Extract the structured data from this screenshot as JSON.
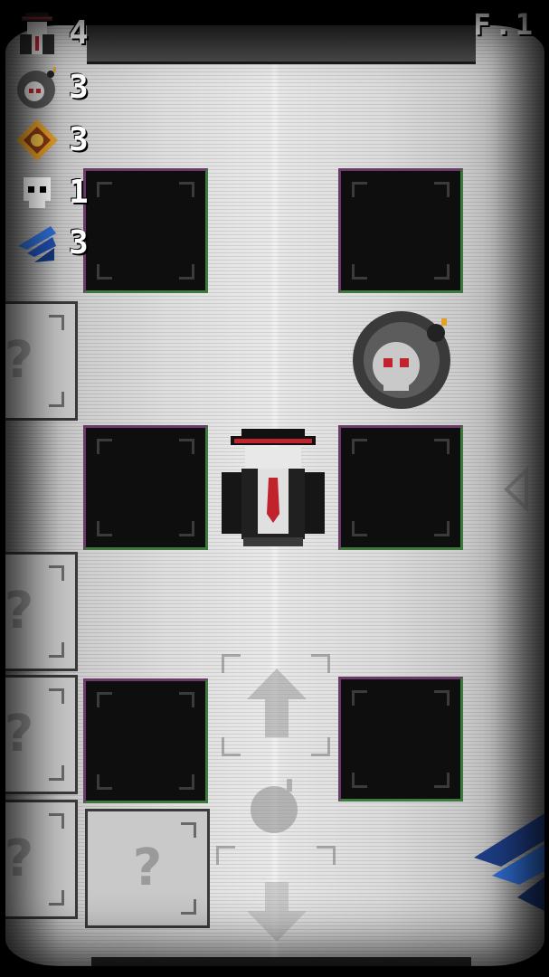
{
  "hud": {
    "lives": {
      "icon": "agent-head-icon",
      "value": "4"
    },
    "bombs": {
      "icon": "skull-bomb-icon",
      "value": "3"
    },
    "compass": {
      "icon": "compass-gem-icon",
      "value": "3"
    },
    "kills": {
      "icon": "skull-icon",
      "value": "1"
    },
    "dashes": {
      "icon": "blue-chevron-icon",
      "value": "3"
    }
  },
  "floor_label": "F.1",
  "unknown_tile_glyph": "?",
  "colors": {
    "floor": "#dedede",
    "pit": "#0e0e0e",
    "accent_red": "#c0232b",
    "dash_blue": "#2f6fd6"
  }
}
